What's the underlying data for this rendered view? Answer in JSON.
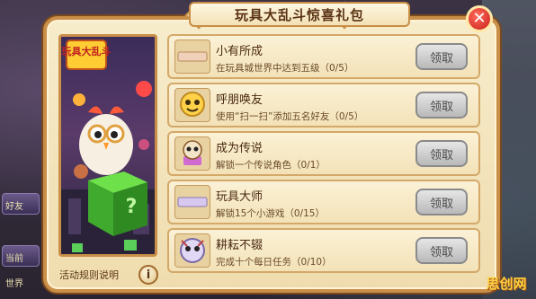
{
  "popup": {
    "title": "玩具大乱斗惊喜礼包",
    "close_symbol": "✕",
    "game_logo": "玩具大乱斗",
    "rules_label": "活动规则说明",
    "info_symbol": "i"
  },
  "tasks": [
    {
      "name": "小有所成",
      "desc": "在玩具城世界中达到五级（0/5）",
      "button": "领取",
      "icon": "blank-scroll-icon"
    },
    {
      "name": "呼朋唤友",
      "desc": "使用“扫一扫”添加五名好友（0/5）",
      "button": "领取",
      "icon": "friends-badge-icon"
    },
    {
      "name": "成为传说",
      "desc": "解锁一个传说角色（0/1）",
      "button": "领取",
      "icon": "legend-character-icon"
    },
    {
      "name": "玩具大师",
      "desc": "解锁15个小游戏（0/15）",
      "button": "领取",
      "icon": "blank-scroll-icon"
    },
    {
      "name": "耕耘不辍",
      "desc": "完成十个每日任务（0/10）",
      "button": "领取",
      "icon": "character-badge-icon"
    }
  ],
  "background": {
    "left_labels": [
      "好友",
      "当前",
      "世界"
    ],
    "watermark": "思创网"
  },
  "colors": {
    "panel_border": "#c98e47",
    "panel_fill": "#f7eccb",
    "close_red": "#c8201a",
    "button_gray": "#b9b9b9"
  }
}
